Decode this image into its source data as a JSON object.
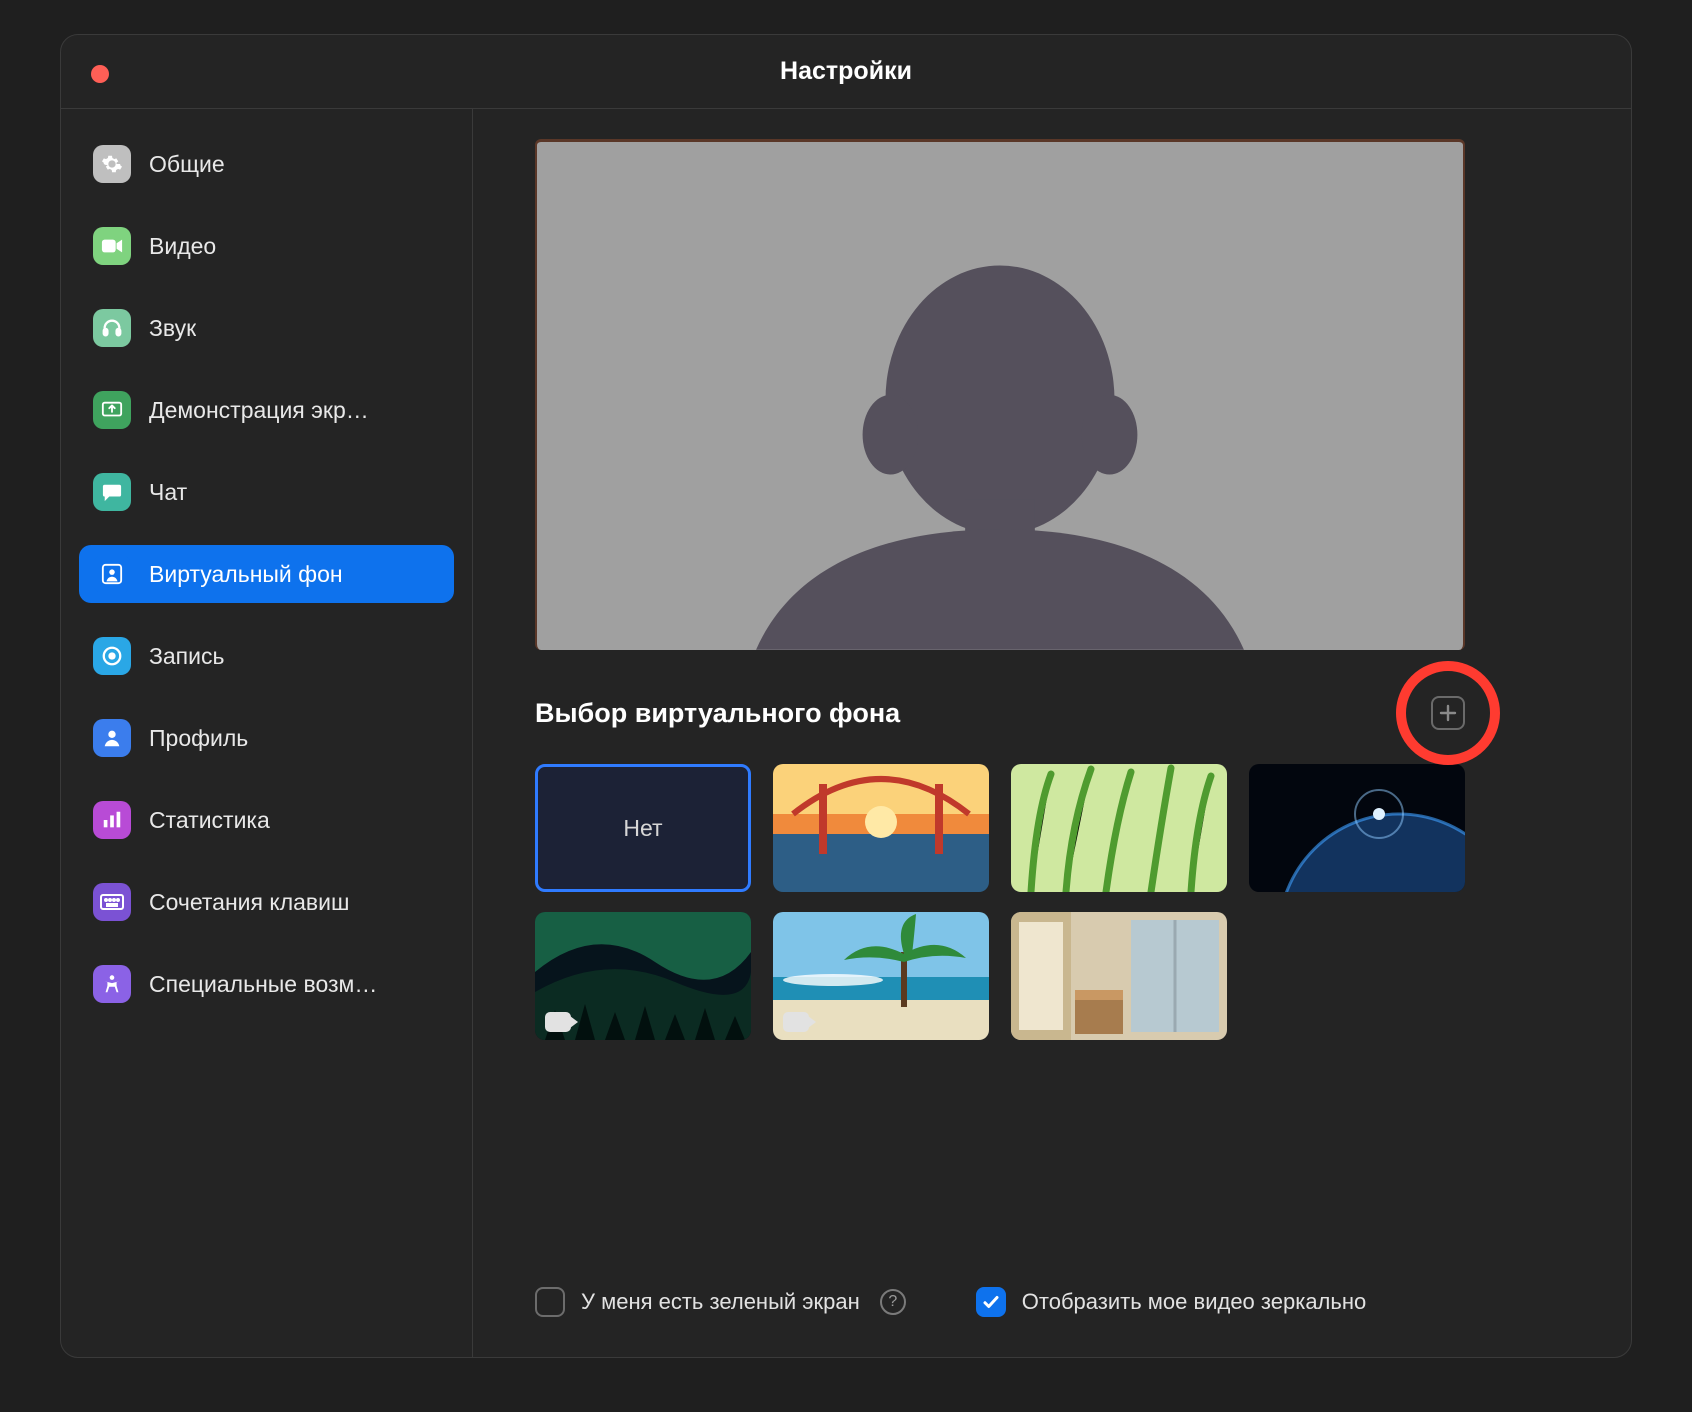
{
  "window": {
    "title": "Настройки"
  },
  "sidebar": {
    "items": [
      {
        "label": "Общие",
        "icon": "gear",
        "color": "#bfbfbf"
      },
      {
        "label": "Видео",
        "icon": "video",
        "color": "#7fd37f"
      },
      {
        "label": "Звук",
        "icon": "headphones",
        "color": "#7cc9a0"
      },
      {
        "label": "Демонстрация экр…",
        "icon": "share",
        "color": "#3fa35e"
      },
      {
        "label": "Чат",
        "icon": "chat",
        "color": "#3fb6a0"
      },
      {
        "label": "Виртуальный фон",
        "icon": "person-bg",
        "color": "#0e72ed",
        "active": true
      },
      {
        "label": "Запись",
        "icon": "record",
        "color": "#2aa7e6"
      },
      {
        "label": "Профиль",
        "icon": "profile",
        "color": "#3b7ded"
      },
      {
        "label": "Статистика",
        "icon": "stats",
        "color": "#b84bd6"
      },
      {
        "label": "Сочетания клавиш",
        "icon": "keyboard",
        "color": "#7b52d4"
      },
      {
        "label": "Специальные возм…",
        "icon": "accessibility",
        "color": "#8b62e6"
      }
    ]
  },
  "main": {
    "section_title": "Выбор виртуального фона",
    "backgrounds": {
      "none_label": "Нет",
      "tiles": [
        {
          "kind": "none",
          "selected": true
        },
        {
          "kind": "bridge",
          "video": false
        },
        {
          "kind": "grass",
          "video": false
        },
        {
          "kind": "earth",
          "video": false
        },
        {
          "kind": "aurora",
          "video": true
        },
        {
          "kind": "beach",
          "video": true
        },
        {
          "kind": "room",
          "video": false
        }
      ]
    },
    "options": {
      "green_screen_label": "У меня есть зеленый экран",
      "green_screen_checked": false,
      "mirror_label": "Отобразить мое видео зеркально",
      "mirror_checked": true
    }
  },
  "annotation": {
    "highlight": "add-background-button"
  }
}
